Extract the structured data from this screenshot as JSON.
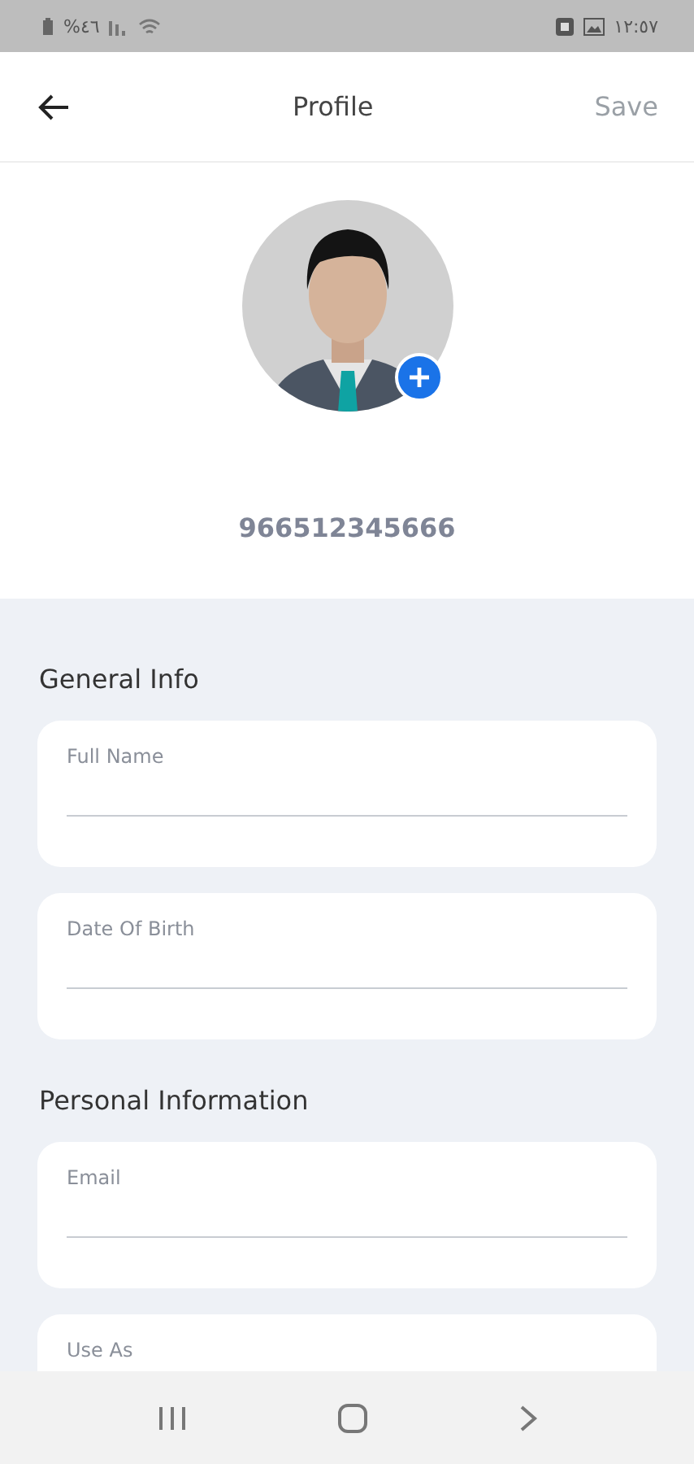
{
  "status_bar": {
    "battery": "%٤٦",
    "time": "١٢:٥٧"
  },
  "header": {
    "title": "Profile",
    "save": "Save"
  },
  "profile": {
    "phone": "966512345666"
  },
  "sections": [
    {
      "title": "General Info",
      "fields": [
        {
          "label": "Full Name"
        },
        {
          "label": "Date Of Birth"
        }
      ]
    },
    {
      "title": "Personal Information",
      "fields": [
        {
          "label": "Email"
        },
        {
          "label": "Use As"
        }
      ]
    }
  ]
}
